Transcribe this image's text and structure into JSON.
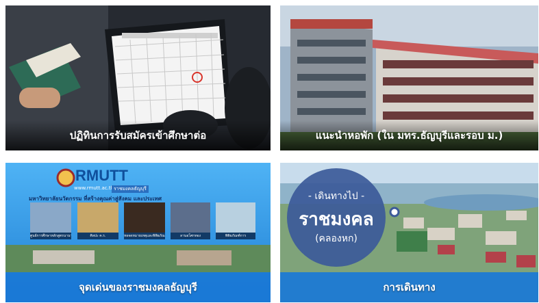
{
  "cards": [
    {
      "caption": "ปฏิทินการรับสมัครเข้าศึกษาต่อ"
    },
    {
      "caption": "แนะนำหอพัก (ใน มทร.ธัญบุรีและรอบ ม.)"
    },
    {
      "caption": "จุดเด่นของราชมงคลธัญบุรี",
      "logo": "RMUTT",
      "website": "www.rmutt.ac.th",
      "tagline": "ราชมงคลธัญบุรี",
      "slogan": "มหาวิทยาลัยนวัตกรรม ที่สร้างคุณค่าสู่สังคม และประเทศ",
      "thumbs": [
        "ศูนย์การศึกษาหลักสูตรนานาชาติ",
        "ศิลปะ ค.ร.",
        "หอจดหมายเหตุและพิพิธภัณฑ์",
        "ลานอโศกทอง",
        "พิพิธภัณฑ์การ"
      ]
    },
    {
      "caption": "การเดินทาง",
      "badge_top": "- เดินทางไป -",
      "badge_main": "ราชมงคล",
      "badge_sub": "(คลองหก)"
    }
  ],
  "colors": {
    "caption_blue": "#1a78d6",
    "badge": "#3c5a99"
  }
}
